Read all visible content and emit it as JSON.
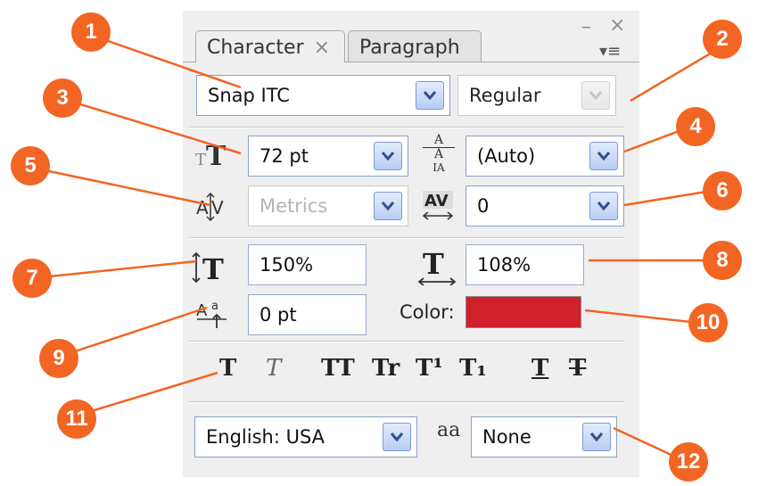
{
  "tabs": [
    {
      "label": "Character",
      "close": "×"
    },
    {
      "label": "Paragraph"
    }
  ],
  "window": {
    "minimize": "–",
    "close": "×",
    "menu": "▾≡"
  },
  "font": {
    "family": "Snap ITC",
    "style": "Regular"
  },
  "size": {
    "value": "72 pt"
  },
  "leading": {
    "value": "(Auto)"
  },
  "kerning": {
    "value": "Metrics"
  },
  "tracking": {
    "value": "0"
  },
  "vertical_scale": {
    "value": "150%"
  },
  "horizontal_scale": {
    "value": "108%"
  },
  "baseline_shift": {
    "value": "0 pt"
  },
  "color": {
    "label": "Color:",
    "swatch": "#d0202e"
  },
  "styles": [
    {
      "name": "faux-bold",
      "glyph": "T"
    },
    {
      "name": "faux-italic",
      "glyph": "T"
    },
    {
      "name": "all-caps",
      "glyph": "TT"
    },
    {
      "name": "small-caps",
      "glyph": "Tr"
    },
    {
      "name": "superscript",
      "glyph": "T¹"
    },
    {
      "name": "subscript",
      "glyph": "T₁"
    },
    {
      "name": "underline",
      "glyph": "T"
    },
    {
      "name": "strikethrough",
      "glyph": "T"
    }
  ],
  "language": {
    "value": "English: USA"
  },
  "antialias": {
    "icon": "aa",
    "value": "None"
  },
  "callouts": [
    "1",
    "2",
    "3",
    "4",
    "5",
    "6",
    "7",
    "8",
    "9",
    "10",
    "11",
    "12"
  ],
  "accent": "#f26522"
}
